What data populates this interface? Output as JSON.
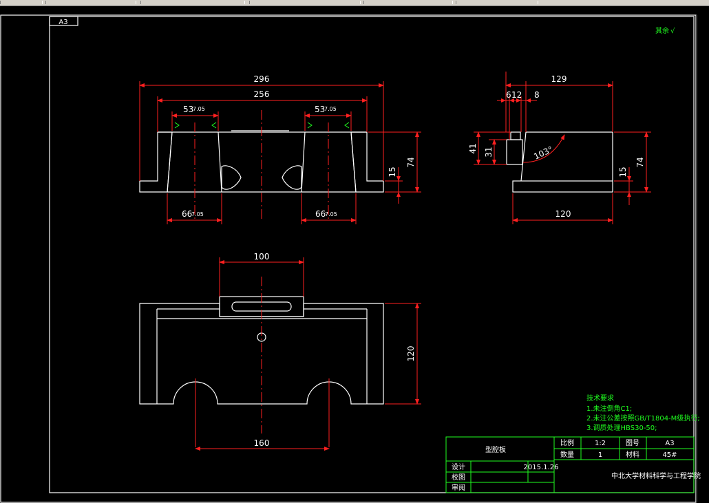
{
  "sheet": {
    "size_label": "A3",
    "roughness_note": "其余",
    "roughness_symbol": "√"
  },
  "front_view": {
    "dims": {
      "overall_width": "296",
      "inner_width": "256",
      "slot_top_left": "53",
      "slot_top_left_tol": "7.05",
      "slot_top_right": "53",
      "slot_top_right_tol": "7.05",
      "slot_bottom_left": "66",
      "slot_bottom_left_tol": "7.05",
      "slot_bottom_right": "66",
      "slot_bottom_right_tol": "7.05",
      "height_total": "74",
      "height_base": "15"
    }
  },
  "side_view": {
    "dims": {
      "overall_width": "129",
      "small_6": "6",
      "small_12": "12",
      "small_8": "8",
      "height_41": "41",
      "height_31": "31",
      "angle": "103°",
      "height_base": "15",
      "height_total": "74",
      "bottom_width": "120"
    }
  },
  "top_view": {
    "dims": {
      "slot_width": "100",
      "depth": "120",
      "arc_spacing": "160"
    }
  },
  "tech_requirements": {
    "title": "技术要求",
    "items": [
      "1.未注倒角C1;",
      "2.未注公差按照GB/T1804-M级执行;",
      "3.调质处理HBS30-50;"
    ]
  },
  "title_block": {
    "part_name": "型腔板",
    "scale_label": "比例",
    "scale_value": "1:2",
    "drawing_no_label": "图号",
    "drawing_no_value": "A3",
    "qty_label": "数量",
    "qty_value": "1",
    "material_label": "材料",
    "material_value": "45#",
    "design_label": "设计",
    "design_date": "2015.1.26",
    "check_label": "校图",
    "approve_label": "审阅",
    "school": "中北大学材料科学与工程学院"
  }
}
